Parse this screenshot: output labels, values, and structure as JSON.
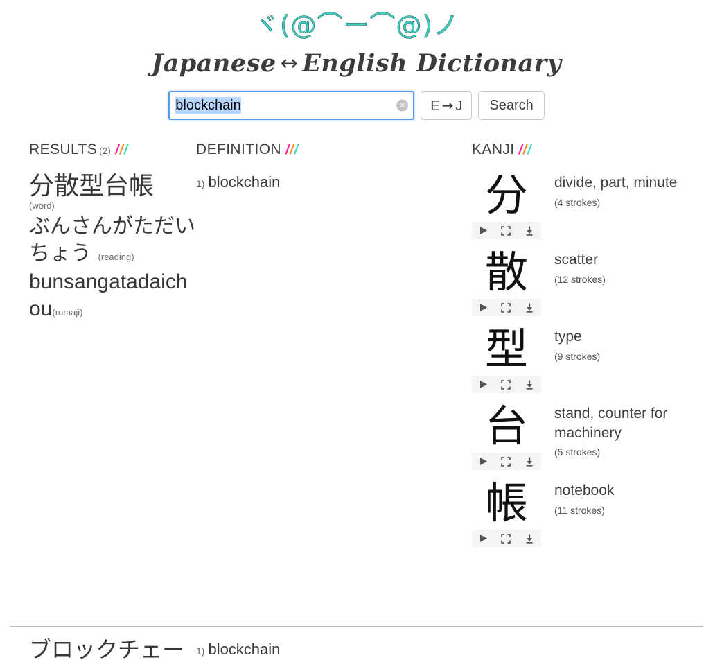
{
  "header": {
    "kaomoji": "ヾ(@⌒ー⌒@)ノ",
    "title_left": "Japanese",
    "title_arrow": "↔",
    "title_right": "English Dictionary"
  },
  "search": {
    "value": "blockchain",
    "placeholder": "",
    "clear_icon": "×",
    "lang_button_left": "E",
    "lang_button_arrow": "→",
    "lang_button_right": "J",
    "search_button": "Search"
  },
  "columns": {
    "results": {
      "label": "RESULTS",
      "count": "(2)"
    },
    "definition": {
      "label": "DEFINITION"
    },
    "kanji": {
      "label": "KANJI"
    }
  },
  "accent_colors": {
    "slash_pink": "#ff1e8e",
    "slash_orange": "#ff8a1e",
    "slash_teal": "#3fd9c3",
    "kaomoji": "#3fd0c0",
    "input_border": "#5a9bec",
    "selection": "#b5d6fd"
  },
  "entry": {
    "word": "分散型台帳",
    "word_tag": "(word)",
    "reading": "ぶんさんがただいちょう",
    "reading_tag": "(reading)",
    "romaji": "bunsangatadaichou",
    "romaji_tag": "(romaji)",
    "definitions": [
      {
        "num": "1)",
        "text": "blockchain"
      }
    ]
  },
  "kanji_list": [
    {
      "char": "分",
      "meaning": "divide, part, minute",
      "strokes": "(4 strokes)"
    },
    {
      "char": "散",
      "meaning": "scatter",
      "strokes": "(12 strokes)"
    },
    {
      "char": "型",
      "meaning": "type",
      "strokes": "(9 strokes)"
    },
    {
      "char": "台",
      "meaning": "stand, counter for machinery",
      "strokes": "(5 strokes)"
    },
    {
      "char": "帳",
      "meaning": "notebook",
      "strokes": "(11 strokes)"
    }
  ],
  "kanji_tools": {
    "play": "play-icon",
    "fullscreen": "fullscreen-icon",
    "download": "download-icon"
  },
  "second_entry": {
    "word": "ブロックチェー",
    "def_num": "1)",
    "def_text": "blockchain"
  }
}
